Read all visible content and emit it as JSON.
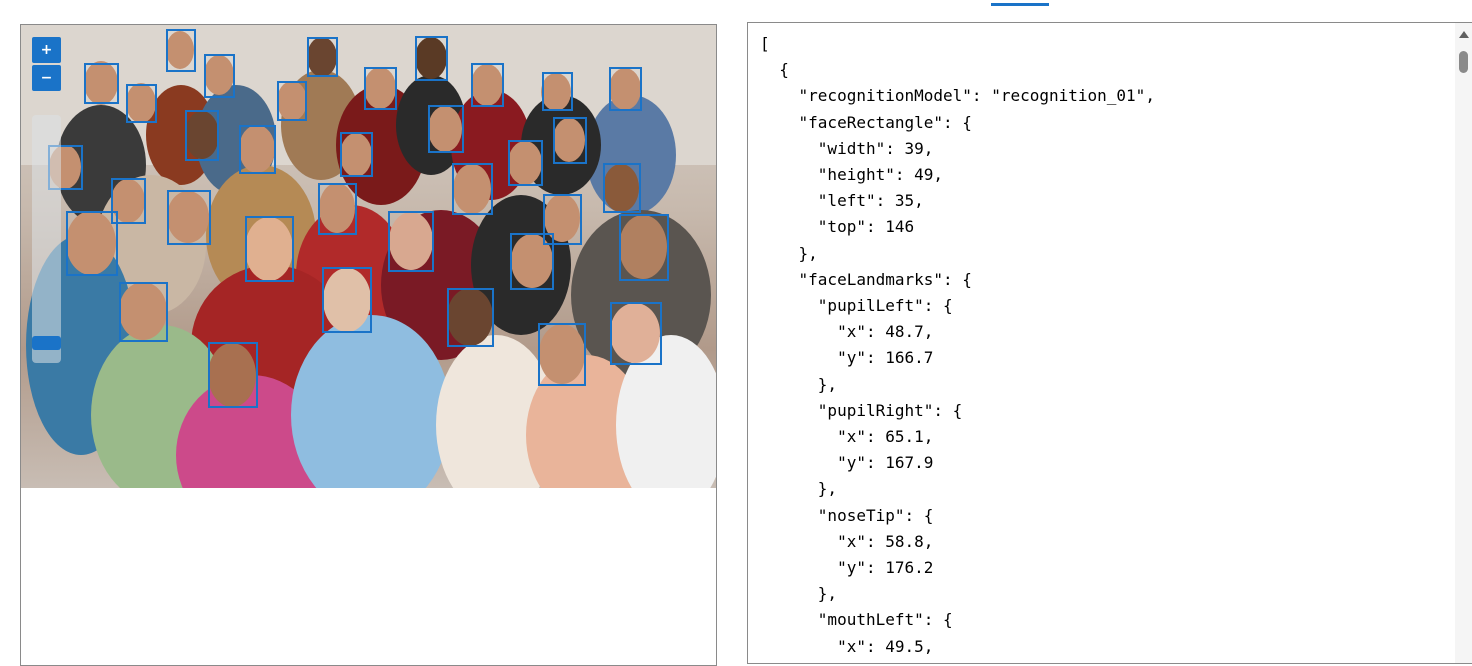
{
  "zoom": {
    "in_label": "+",
    "out_label": "−",
    "level": 0.04
  },
  "face_count": 32,
  "json_text": "[\n  {\n    \"recognitionModel\": \"recognition_01\",\n    \"faceRectangle\": {\n      \"width\": 39,\n      \"height\": 49,\n      \"left\": 35,\n      \"top\": 146\n    },\n    \"faceLandmarks\": {\n      \"pupilLeft\": {\n        \"x\": 48.7,\n        \"y\": 166.7\n      },\n      \"pupilRight\": {\n        \"x\": 65.1,\n        \"y\": 167.9\n      },\n      \"noseTip\": {\n        \"x\": 58.8,\n        \"y\": 176.2\n      },\n      \"mouthLeft\": {\n        \"x\": 49.5,",
  "colors": {
    "accent": "#1a73c8",
    "border": "#8a8a8a"
  }
}
